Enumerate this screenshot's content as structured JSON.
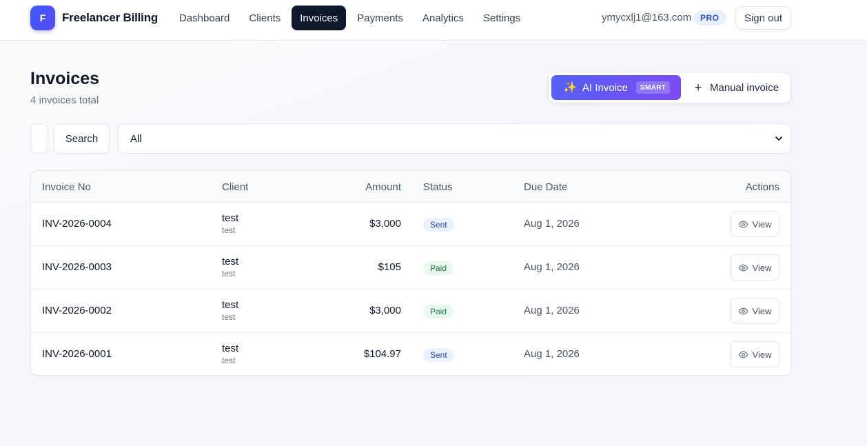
{
  "brand": {
    "logo_letter": "F",
    "name": "Freelancer Billing"
  },
  "nav": {
    "items": [
      {
        "label": "Dashboard",
        "active": false
      },
      {
        "label": "Clients",
        "active": false
      },
      {
        "label": "Invoices",
        "active": true
      },
      {
        "label": "Payments",
        "active": false
      },
      {
        "label": "Analytics",
        "active": false
      },
      {
        "label": "Settings",
        "active": false
      }
    ]
  },
  "user": {
    "email": "ymycxlj1@163.com",
    "plan_badge": "PRO",
    "signout_label": "Sign out"
  },
  "header": {
    "title": "Invoices",
    "subtitle": "4 invoices total",
    "ai_button": {
      "icon": "sparkles-icon",
      "label": "AI Invoice",
      "badge": "SMART"
    },
    "manual_button": {
      "icon": "plus-icon",
      "label": "Manual invoice"
    }
  },
  "filters": {
    "search_value": "",
    "search_placeholder": "",
    "search_button_label": "Search",
    "status_selected": "All"
  },
  "table": {
    "columns": [
      "Invoice No",
      "Client",
      "Amount",
      "Status",
      "Due Date",
      "Actions"
    ],
    "rows": [
      {
        "invoice_no": "INV-2026-0004",
        "client_name": "test",
        "client_sub": "test",
        "amount": "$3,000",
        "status": "Sent",
        "due_date": "Aug 1, 2026",
        "action": "View"
      },
      {
        "invoice_no": "INV-2026-0003",
        "client_name": "test",
        "client_sub": "test",
        "amount": "$105",
        "status": "Paid",
        "due_date": "Aug 1, 2026",
        "action": "View"
      },
      {
        "invoice_no": "INV-2026-0002",
        "client_name": "test",
        "client_sub": "test",
        "amount": "$3,000",
        "status": "Paid",
        "due_date": "Aug 1, 2026",
        "action": "View"
      },
      {
        "invoice_no": "INV-2026-0001",
        "client_name": "test",
        "client_sub": "test",
        "amount": "$104.97",
        "status": "Sent",
        "due_date": "Aug 1, 2026",
        "action": "View"
      }
    ]
  },
  "colors": {
    "accent_gradient_start": "#5560f6",
    "accent_gradient_end": "#7a4cf2",
    "nav_active_bg": "#0f172a",
    "status_sent": "#2748b8",
    "status_paid": "#1f7a3d"
  }
}
